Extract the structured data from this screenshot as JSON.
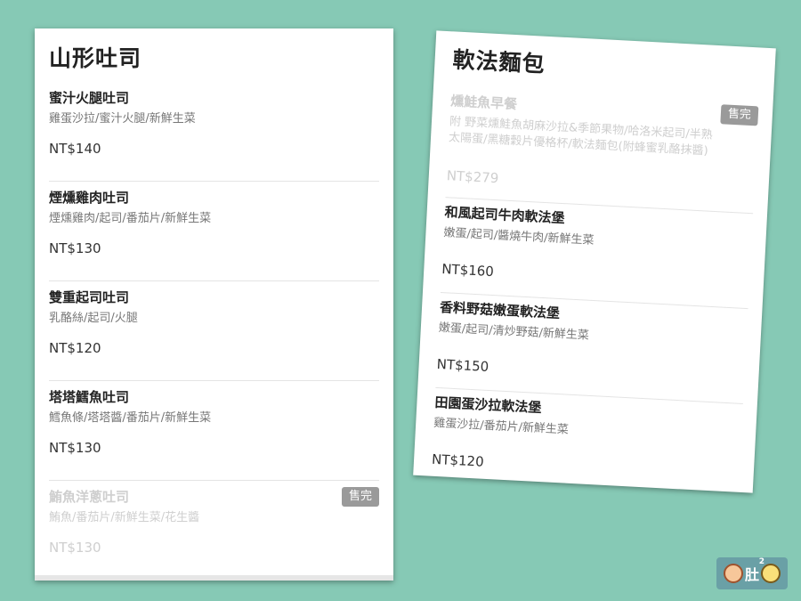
{
  "left_section": {
    "title": "山形吐司",
    "items": [
      {
        "name": "蜜汁火腿吐司",
        "desc": "雞蛋沙拉/蜜汁火腿/新鮮生菜",
        "price": "NT$140"
      },
      {
        "name": "煙燻雞肉吐司",
        "desc": "煙燻雞肉/起司/番茄片/新鮮生菜",
        "price": "NT$130"
      },
      {
        "name": "雙重起司吐司",
        "desc": "乳酪絲/起司/火腿",
        "price": "NT$120"
      },
      {
        "name": "塔塔鱈魚吐司",
        "desc": "鱈魚條/塔塔醬/番茄片/新鮮生菜",
        "price": "NT$130"
      },
      {
        "name": "鮪魚洋蔥吐司",
        "desc": "鮪魚/番茄片/新鮮生菜/花生醬",
        "price": "NT$130",
        "badge": "售完"
      }
    ]
  },
  "right_section": {
    "title": "軟法麵包",
    "items": [
      {
        "name": "燻鮭魚早餐",
        "desc": "附 野菜燻鮭魚胡麻沙拉&季節果物/哈洛米起司/半熟太陽蛋/黑糖穀片優格杯/軟法麵包(附蜂蜜乳酪抹醬)",
        "price": "NT$279",
        "badge": "售完"
      },
      {
        "name": "和風起司牛肉軟法堡",
        "desc": "嫩蛋/起司/醬燒牛肉/新鮮生菜",
        "price": "NT$160"
      },
      {
        "name": "香料野菇嫩蛋軟法堡",
        "desc": "嫩蛋/起司/清炒野菇/新鮮生菜",
        "price": "NT$150"
      },
      {
        "name": "田園蛋沙拉軟法堡",
        "desc": "雞蛋沙拉/番茄片/新鮮生菜",
        "price": "NT$120"
      }
    ]
  },
  "logo": {
    "text": "肚",
    "sup": "2"
  },
  "colors": {
    "background": "#86c9b5",
    "badge": "#9a9a9a",
    "sold_text": "#cfcfcf"
  }
}
